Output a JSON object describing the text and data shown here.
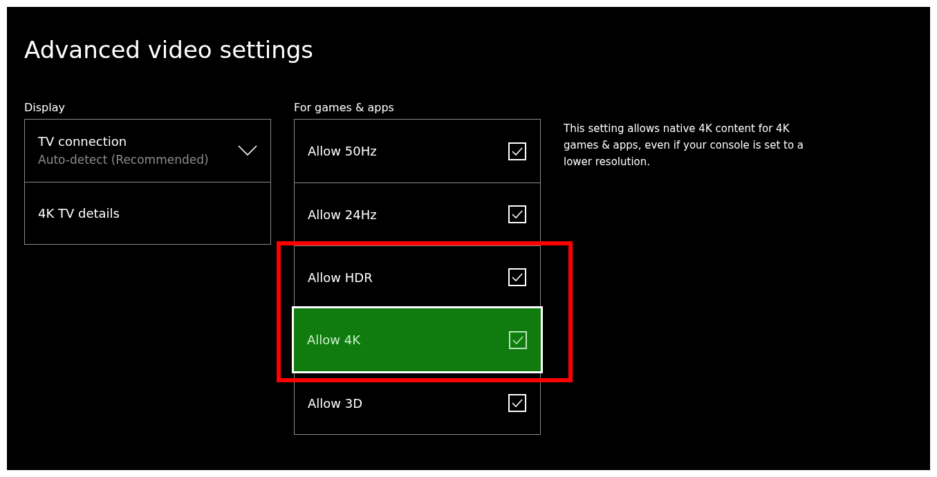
{
  "title": "Advanced video settings",
  "display": {
    "label": "Display",
    "items": [
      {
        "kind": "dropdown",
        "label": "TV connection",
        "value": "Auto-detect (Recommended)"
      },
      {
        "kind": "link",
        "label": "4K TV details"
      }
    ]
  },
  "games_apps": {
    "label": "For games & apps",
    "options": [
      {
        "label": "Allow 50Hz",
        "checked": true,
        "selected": false,
        "highlighted": false
      },
      {
        "label": "Allow 24Hz",
        "checked": true,
        "selected": false,
        "highlighted": false
      },
      {
        "label": "Allow HDR",
        "checked": true,
        "selected": false,
        "highlighted": true
      },
      {
        "label": "Allow 4K",
        "checked": true,
        "selected": true,
        "highlighted": true
      },
      {
        "label": "Allow 3D",
        "checked": true,
        "selected": false,
        "highlighted": false
      }
    ]
  },
  "description": "This setting allows native 4K content for 4K games & apps, even if your console is set to a lower resolution."
}
